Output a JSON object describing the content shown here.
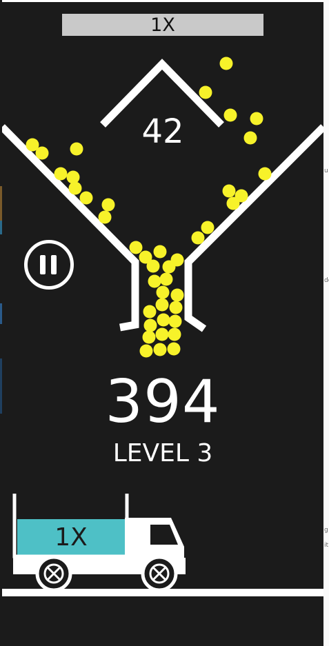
{
  "multiplier_bar": {
    "label": "1X"
  },
  "target": {
    "count": "42"
  },
  "score": {
    "value": "394"
  },
  "level": {
    "label": "LEVEL 3"
  },
  "truck": {
    "multiplier_label": "1X"
  },
  "controls": {
    "pause": "pause-icon"
  },
  "colors": {
    "background": "#1b1b1b",
    "ball": "#f7f22a",
    "truck_fill": "#4ec0c6",
    "lines": "#ffffff",
    "multiplier_bar": "#c9c9c9"
  }
}
